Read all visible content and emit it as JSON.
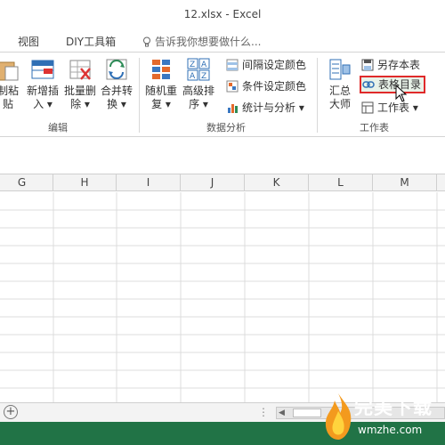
{
  "window": {
    "title": "12.xlsx - Excel"
  },
  "tabs": [
    {
      "label": "视图"
    },
    {
      "label": "DIY工具箱"
    }
  ],
  "tell_me": {
    "placeholder": "告诉我你想要做什么..."
  },
  "ribbon": {
    "big_buttons": [
      {
        "label_line1": "制粘",
        "label_line2": "贴"
      },
      {
        "label_line1": "新增插",
        "label_line2": "入 ▾"
      },
      {
        "label_line1": "批量删",
        "label_line2": "除 ▾"
      },
      {
        "label_line1": "合并转",
        "label_line2": "换 ▾"
      },
      {
        "label_line1": "随机重",
        "label_line2": "复 ▾"
      },
      {
        "label_line1": "高级排",
        "label_line2": "序 ▾"
      },
      {
        "label_line1": "汇总",
        "label_line2": "大师"
      }
    ],
    "small_buttons": [
      {
        "label": "间隔设定颜色"
      },
      {
        "label": "条件设定颜色"
      },
      {
        "label": "统计与分析 ▾"
      },
      {
        "label": "另存本表"
      },
      {
        "label": "表格目录"
      },
      {
        "label": "工作表 ▾"
      }
    ],
    "groups": [
      {
        "label": "编辑"
      },
      {
        "label": "数据分析"
      },
      {
        "label": "工作表"
      }
    ]
  },
  "columns": [
    "G",
    "H",
    "I",
    "J",
    "K",
    "L",
    "M"
  ],
  "sheet_bar": {
    "add_label": "+",
    "dots": "⋮",
    "scroll_left": "◀"
  },
  "watermark": {
    "text": "完美下载",
    "sub": "wmzhe.com"
  },
  "colors": {
    "accent": "#217346",
    "highlight_border": "#e02a2a",
    "highlight_bg": "#e8f2e8"
  }
}
